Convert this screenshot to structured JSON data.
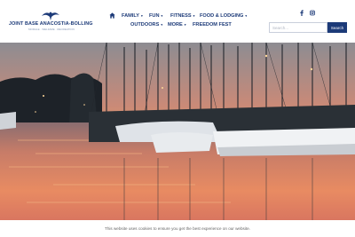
{
  "brand": {
    "title": "JOINT BASE ANACOSTIA-BOLLING",
    "subtitle": "MORALE · WELFARE · RECREATION",
    "logo_icon": "eagle-icon"
  },
  "nav": {
    "home_icon": "home-icon",
    "row1": [
      {
        "label": "FAMILY",
        "dropdown": true
      },
      {
        "label": "FUN",
        "dropdown": true
      },
      {
        "label": "FITNESS",
        "dropdown": true
      },
      {
        "label": "FOOD & LODGING",
        "dropdown": true
      }
    ],
    "row2": [
      {
        "label": "OUTDOORS",
        "dropdown": true
      },
      {
        "label": "MORE",
        "dropdown": true
      },
      {
        "label": "FREEDOM FEST",
        "dropdown": false
      }
    ]
  },
  "social": [
    {
      "name": "facebook-icon",
      "glyph": "f"
    },
    {
      "name": "instagram-icon",
      "glyph": "ig"
    }
  ],
  "search": {
    "placeholder": "Search...",
    "value": "",
    "button_label": "Search"
  },
  "hero": {
    "description": "marina-at-sunset",
    "colors": {
      "sky_top": "#8a8a8e",
      "sky_glow": "#e88a55",
      "water": "#d9826a",
      "brand": "#1c3a78"
    }
  },
  "cookie_banner": {
    "text": "This website uses cookies to ensure you get the best experience on our website."
  }
}
